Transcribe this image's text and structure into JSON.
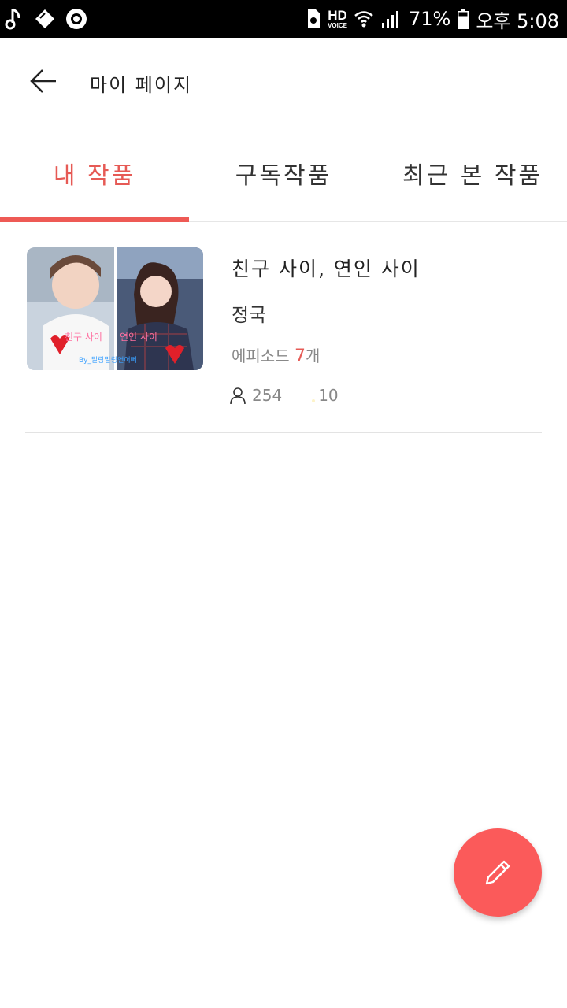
{
  "status_bar": {
    "icons_left": [
      "music-note-icon",
      "tag-icon",
      "camera-lens-icon"
    ],
    "hd_label": "HD",
    "voice_label": "VOICE",
    "battery_percent": "71%",
    "time": "오후 5:08",
    "battery_level": 0.71
  },
  "header": {
    "title": "마이 페이지",
    "back_icon": "arrow-left-icon"
  },
  "tabs": [
    {
      "label": "내 작품",
      "active": true
    },
    {
      "label": "구독작품",
      "active": false
    },
    {
      "label": "최근 본 작품",
      "active": false
    }
  ],
  "works": [
    {
      "title": "친구 사이, 연인 사이",
      "author": "정국",
      "episodes_label": "에피소드",
      "episodes_count": "7",
      "episodes_unit": "개",
      "views": "254",
      "likes": "10",
      "thumbnail_text_left": "친구 사이",
      "thumbnail_text_right": "연인 사이",
      "thumbnail_credit": "By_말랑말랑연어삐"
    }
  ],
  "fab": {
    "icon": "pencil-icon"
  },
  "colors": {
    "accent": "#ee5a55",
    "fab": "#fb5a5a",
    "divider": "#e6e6e6"
  }
}
